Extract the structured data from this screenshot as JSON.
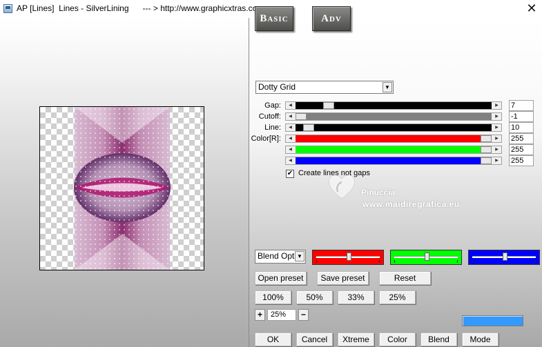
{
  "window": {
    "title": "AP [Lines]  Lines - SilverLining      --- > http://www.graphicxtras.com",
    "close_glyph": "✕"
  },
  "tabs": [
    {
      "label": "Basic"
    },
    {
      "label": "Adv"
    }
  ],
  "mode_select": {
    "value": "Dotty Grid"
  },
  "sliders": [
    {
      "label": "Gap:",
      "value": "7",
      "fill_color": "#000000",
      "level": 0.15
    },
    {
      "label": "Cutoff:",
      "value": "-1",
      "fill_color": "#808080",
      "level": 0.0
    },
    {
      "label": "Line:",
      "value": "10",
      "fill_color": "#000000",
      "level": 0.04
    },
    {
      "label": "Color[R]:",
      "value": "255",
      "fill_color": "#ff0000",
      "level": 1.0
    },
    {
      "label": "",
      "value": "255",
      "fill_color": "#00ff00",
      "level": 1.0
    },
    {
      "label": "",
      "value": "255",
      "fill_color": "#0000ff",
      "level": 1.0
    }
  ],
  "checkbox": {
    "label": "Create lines not gaps",
    "checked": true,
    "check_glyph": "✔"
  },
  "watermark": {
    "name": "Pinuccia",
    "url": "www.maidiregrafica.eu"
  },
  "blend": {
    "select_value": "Blend Optio",
    "colors": [
      {
        "color": "#ff0000",
        "level": 0.5
      },
      {
        "color": "#00ff00",
        "level": 0.5
      },
      {
        "color": "#0000ff",
        "level": 0.5
      }
    ]
  },
  "preset_buttons": {
    "open": "Open preset",
    "save": "Save preset",
    "reset": "Reset"
  },
  "zoom_buttons": [
    "100%",
    "50%",
    "33%",
    "25%"
  ],
  "zoom": {
    "minus": "+",
    "value": "25%",
    "plus": "−"
  },
  "accent_swatch": "#3399ff",
  "bottom_buttons": [
    "OK",
    "Cancel",
    "Xtreme",
    "Color",
    "Blend",
    "Mode"
  ]
}
